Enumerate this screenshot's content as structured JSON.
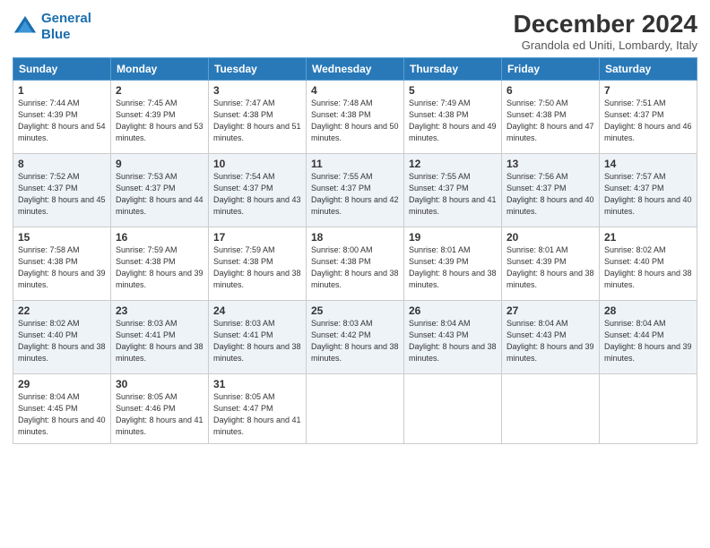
{
  "header": {
    "logo_line1": "General",
    "logo_line2": "Blue",
    "month_year": "December 2024",
    "location": "Grandola ed Uniti, Lombardy, Italy"
  },
  "days_of_week": [
    "Sunday",
    "Monday",
    "Tuesday",
    "Wednesday",
    "Thursday",
    "Friday",
    "Saturday"
  ],
  "weeks": [
    [
      {
        "day": "1",
        "sunrise": "7:44 AM",
        "sunset": "4:39 PM",
        "daylight": "8 hours and 54 minutes."
      },
      {
        "day": "2",
        "sunrise": "7:45 AM",
        "sunset": "4:39 PM",
        "daylight": "8 hours and 53 minutes."
      },
      {
        "day": "3",
        "sunrise": "7:47 AM",
        "sunset": "4:38 PM",
        "daylight": "8 hours and 51 minutes."
      },
      {
        "day": "4",
        "sunrise": "7:48 AM",
        "sunset": "4:38 PM",
        "daylight": "8 hours and 50 minutes."
      },
      {
        "day": "5",
        "sunrise": "7:49 AM",
        "sunset": "4:38 PM",
        "daylight": "8 hours and 49 minutes."
      },
      {
        "day": "6",
        "sunrise": "7:50 AM",
        "sunset": "4:38 PM",
        "daylight": "8 hours and 47 minutes."
      },
      {
        "day": "7",
        "sunrise": "7:51 AM",
        "sunset": "4:37 PM",
        "daylight": "8 hours and 46 minutes."
      }
    ],
    [
      {
        "day": "8",
        "sunrise": "7:52 AM",
        "sunset": "4:37 PM",
        "daylight": "8 hours and 45 minutes."
      },
      {
        "day": "9",
        "sunrise": "7:53 AM",
        "sunset": "4:37 PM",
        "daylight": "8 hours and 44 minutes."
      },
      {
        "day": "10",
        "sunrise": "7:54 AM",
        "sunset": "4:37 PM",
        "daylight": "8 hours and 43 minutes."
      },
      {
        "day": "11",
        "sunrise": "7:55 AM",
        "sunset": "4:37 PM",
        "daylight": "8 hours and 42 minutes."
      },
      {
        "day": "12",
        "sunrise": "7:55 AM",
        "sunset": "4:37 PM",
        "daylight": "8 hours and 41 minutes."
      },
      {
        "day": "13",
        "sunrise": "7:56 AM",
        "sunset": "4:37 PM",
        "daylight": "8 hours and 40 minutes."
      },
      {
        "day": "14",
        "sunrise": "7:57 AM",
        "sunset": "4:37 PM",
        "daylight": "8 hours and 40 minutes."
      }
    ],
    [
      {
        "day": "15",
        "sunrise": "7:58 AM",
        "sunset": "4:38 PM",
        "daylight": "8 hours and 39 minutes."
      },
      {
        "day": "16",
        "sunrise": "7:59 AM",
        "sunset": "4:38 PM",
        "daylight": "8 hours and 39 minutes."
      },
      {
        "day": "17",
        "sunrise": "7:59 AM",
        "sunset": "4:38 PM",
        "daylight": "8 hours and 38 minutes."
      },
      {
        "day": "18",
        "sunrise": "8:00 AM",
        "sunset": "4:38 PM",
        "daylight": "8 hours and 38 minutes."
      },
      {
        "day": "19",
        "sunrise": "8:01 AM",
        "sunset": "4:39 PM",
        "daylight": "8 hours and 38 minutes."
      },
      {
        "day": "20",
        "sunrise": "8:01 AM",
        "sunset": "4:39 PM",
        "daylight": "8 hours and 38 minutes."
      },
      {
        "day": "21",
        "sunrise": "8:02 AM",
        "sunset": "4:40 PM",
        "daylight": "8 hours and 38 minutes."
      }
    ],
    [
      {
        "day": "22",
        "sunrise": "8:02 AM",
        "sunset": "4:40 PM",
        "daylight": "8 hours and 38 minutes."
      },
      {
        "day": "23",
        "sunrise": "8:03 AM",
        "sunset": "4:41 PM",
        "daylight": "8 hours and 38 minutes."
      },
      {
        "day": "24",
        "sunrise": "8:03 AM",
        "sunset": "4:41 PM",
        "daylight": "8 hours and 38 minutes."
      },
      {
        "day": "25",
        "sunrise": "8:03 AM",
        "sunset": "4:42 PM",
        "daylight": "8 hours and 38 minutes."
      },
      {
        "day": "26",
        "sunrise": "8:04 AM",
        "sunset": "4:43 PM",
        "daylight": "8 hours and 38 minutes."
      },
      {
        "day": "27",
        "sunrise": "8:04 AM",
        "sunset": "4:43 PM",
        "daylight": "8 hours and 39 minutes."
      },
      {
        "day": "28",
        "sunrise": "8:04 AM",
        "sunset": "4:44 PM",
        "daylight": "8 hours and 39 minutes."
      }
    ],
    [
      {
        "day": "29",
        "sunrise": "8:04 AM",
        "sunset": "4:45 PM",
        "daylight": "8 hours and 40 minutes."
      },
      {
        "day": "30",
        "sunrise": "8:05 AM",
        "sunset": "4:46 PM",
        "daylight": "8 hours and 41 minutes."
      },
      {
        "day": "31",
        "sunrise": "8:05 AM",
        "sunset": "4:47 PM",
        "daylight": "8 hours and 41 minutes."
      },
      null,
      null,
      null,
      null
    ]
  ]
}
